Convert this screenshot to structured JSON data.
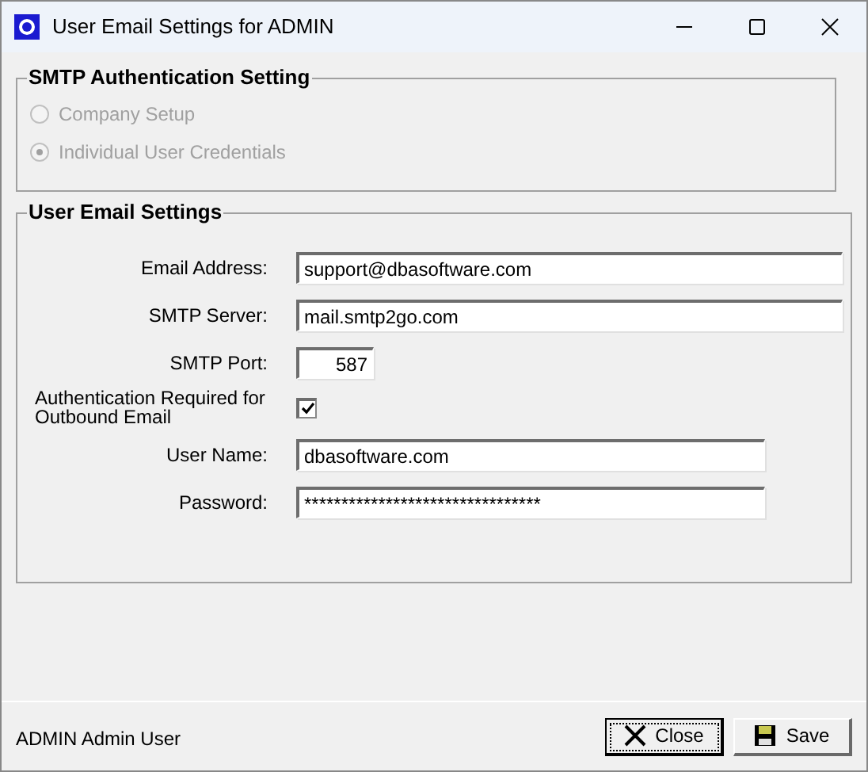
{
  "window": {
    "title": "User Email Settings for ADMIN"
  },
  "auth_group": {
    "title": "SMTP Authentication Setting",
    "options": [
      {
        "label": "Company Setup",
        "selected": false,
        "disabled": true
      },
      {
        "label": "Individual User Credentials",
        "selected": true,
        "disabled": true
      }
    ]
  },
  "email_group": {
    "title": "User Email Settings",
    "fields": [
      {
        "kind": "wide",
        "label": "Email Address:",
        "value": "support@dbasoftware.com"
      },
      {
        "kind": "wide",
        "label": "SMTP Server:",
        "value": "mail.smtp2go.com"
      },
      {
        "kind": "number",
        "label": "SMTP Port:",
        "value": "587"
      },
      {
        "kind": "checkbox",
        "label": "Authentication Required for Outbound Email",
        "checked": true
      },
      {
        "kind": "medium",
        "label": "User Name:",
        "value": "dbasoftware.com"
      },
      {
        "kind": "medium",
        "label": "Password:",
        "value": "********************************"
      }
    ]
  },
  "status_bar": {
    "text": "ADMIN Admin User"
  },
  "buttons": [
    {
      "kind": "close",
      "label": "Close",
      "focused": true
    },
    {
      "kind": "save",
      "label": "Save",
      "focused": false
    }
  ]
}
